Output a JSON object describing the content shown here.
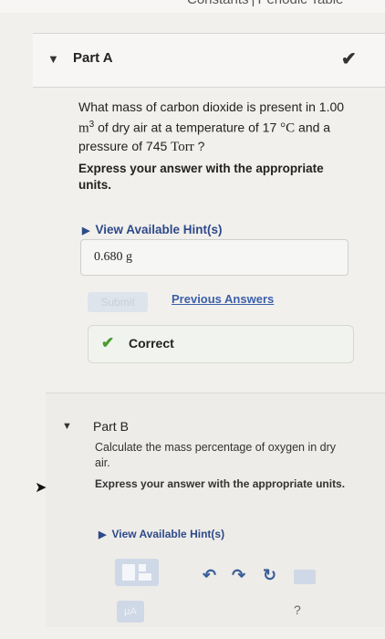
{
  "topbar": {
    "constants_label": "Constants",
    "separator": "|",
    "periodic_label": "Periodic Table"
  },
  "part_a": {
    "title": "Part A",
    "question_intro": "What mass of carbon dioxide is present in 1.00",
    "unit_m": "m",
    "unit_exp": "3",
    "question_mid": " of dry air at a temperature of 17 ",
    "unit_degc": "°C",
    "question_mid2": " and a pressure of 745 ",
    "unit_torr": "Torr",
    "question_end": " ?",
    "instructions": "Express your answer with the appropriate units.",
    "hint_label": "View Available Hint(s)",
    "answer_value": "0.680 g",
    "submit_label": "Submit",
    "previous_answers_label": "Previous Answers",
    "correct_label": "Correct"
  },
  "part_b": {
    "title": "Part B",
    "question": "Calculate the mass percentage of oxygen in dry air.",
    "instructions": "Express your answer with the appropriate units.",
    "hint_label": "View Available Hint(s)",
    "mu_label": "μA",
    "help_label": "?"
  },
  "icons": {
    "caret": "▼",
    "check": "✔",
    "undo": "↶",
    "redo": "↷",
    "reset": "↻"
  },
  "colors": {
    "link": "#3b5fa8",
    "correct": "#4b9a32",
    "toolbar": "#3a5f9a"
  }
}
